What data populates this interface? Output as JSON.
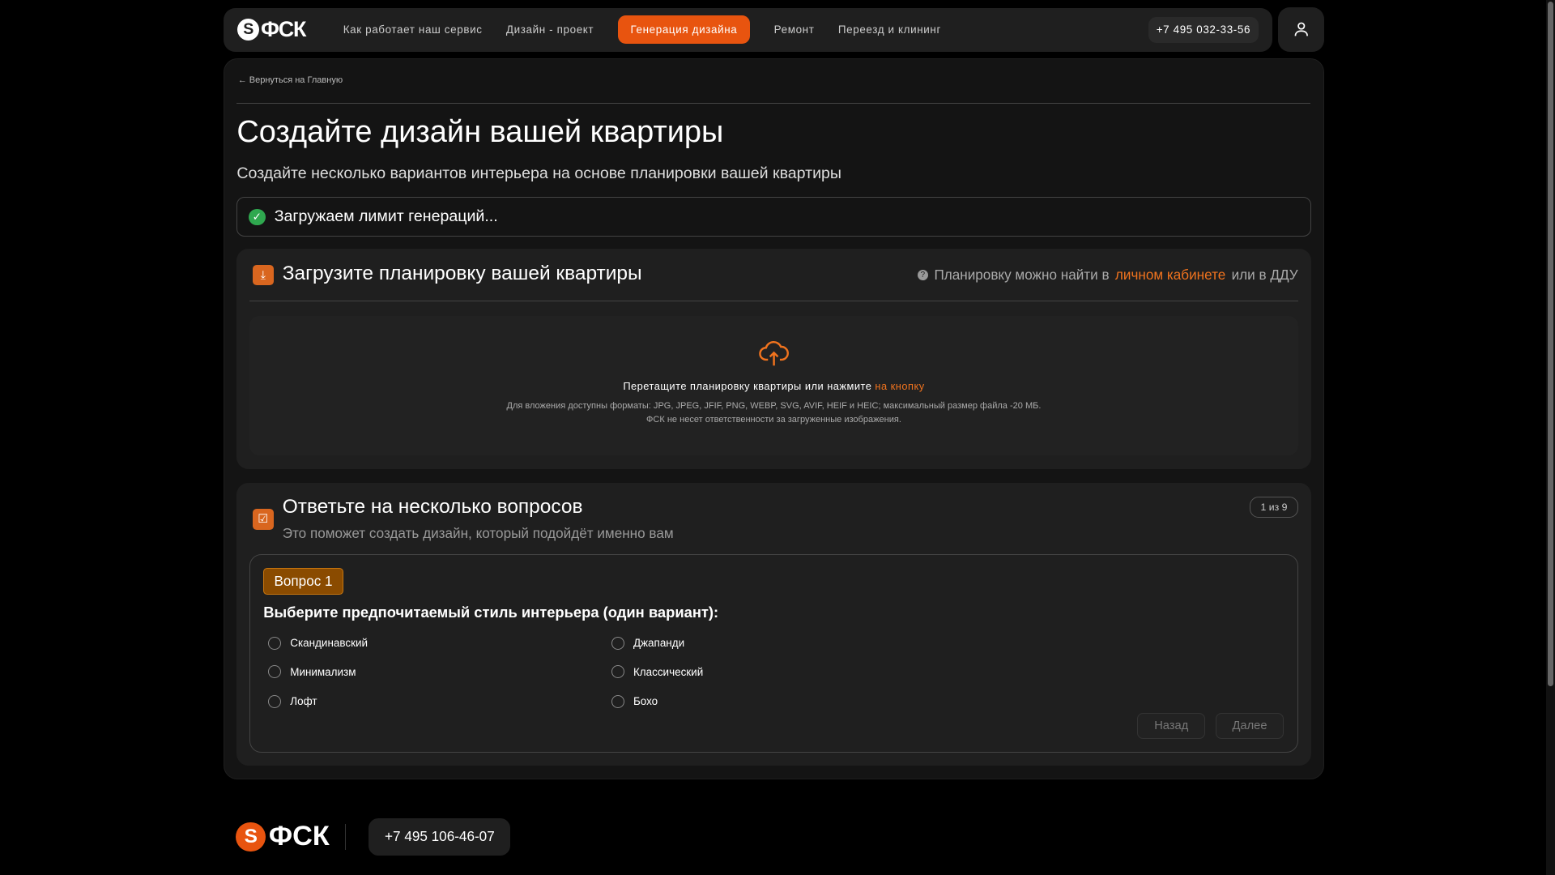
{
  "nav": {
    "logo": "ФСК",
    "links": [
      "Как работает наш сервис",
      "Дизайн - проект",
      "Генерация дизайна",
      "Ремонт",
      "Переезд и клининг"
    ],
    "active": "Генерация дизайна",
    "phone": "+7 495 032-33-56"
  },
  "page": {
    "back": "Вернуться на Главную",
    "title": "Создайте дизайн вашей квартиры",
    "subtitle": "Создайте несколько вариантов интерьера на основе планировки вашей квартиры",
    "limit_status": "Загружаем лимит генераций..."
  },
  "upload": {
    "title": "Загрузите планировку вашей квартиры",
    "hint_pre": "Планировку можно найти в",
    "hint_link": "личном кабинете",
    "hint_post": "или в ДДУ",
    "drop_text": "Перетащите планировку квартиры или нажмите",
    "drop_link": "на кнопку",
    "formats": "Для вложения доступны форматы: JPG, JPEG, JFIF, PNG, WEBP, SVG, AVIF, HEIF и HEIC; максимальный размер файла -20 МБ.",
    "disclaimer": "ФСК не несет ответственности за загруженные изображения."
  },
  "quiz": {
    "title": "Ответьте на несколько вопросов",
    "subtitle": "Это поможет создать дизайн, который подойдёт именно вам",
    "counter": "1 из 9",
    "question_tag": "Вопрос 1",
    "question": "Выберите предпочитаемый стиль интерьера (один вариант):",
    "options": [
      "Скандинавский",
      "Минимализм",
      "Лофт",
      "Джапанди",
      "Классический",
      "Бохо"
    ],
    "back": "Назад",
    "next": "Далее"
  },
  "footer": {
    "logo": "ФСК",
    "phone": "+7 495 106-46-07"
  },
  "colors": {
    "accent": "#e8540f",
    "success": "#2fa84f"
  }
}
